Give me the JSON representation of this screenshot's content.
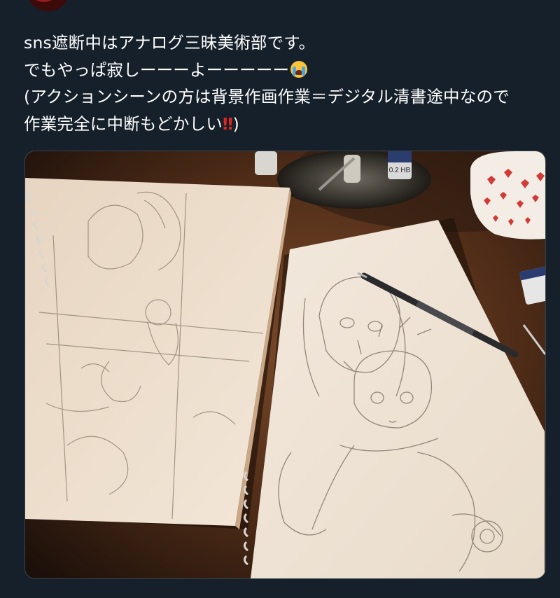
{
  "tweet": {
    "author_avatar": "avatar",
    "handle_partial": "",
    "lines": [
      "sns遮断中はアナログ三昧美術部です。",
      "でもやっぱ寂しーーーよーーーーー",
      "(アクションシーンの方は背景作画作業＝デジタル清書途中なので",
      "作業完全に中断もどかしい"
    ],
    "line4_suffix": ")",
    "emoji_cry": "loudly-crying-face-icon",
    "emoji_bang": "‼"
  },
  "media": {
    "label": "photo-of-pencil-sketches",
    "pencil_lead_label": "0.2 HB"
  },
  "colors": {
    "background": "#15202b",
    "text": "#ffffff",
    "border": "#38444d",
    "table_wood": "#5a3420",
    "paper": "#efe3d2"
  }
}
